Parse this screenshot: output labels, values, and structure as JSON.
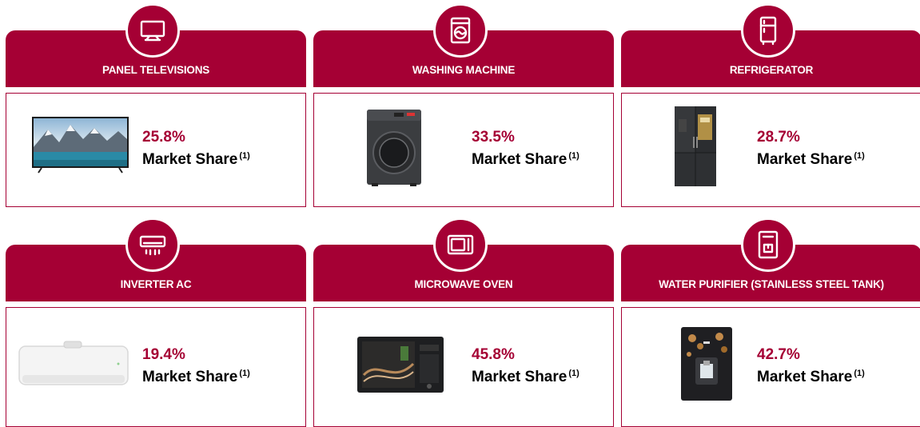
{
  "cards": [
    {
      "title": "PANEL TELEVISIONS",
      "percent": "25.8%",
      "label": "Market Share",
      "note": "(1)",
      "icon": "tv-icon",
      "image": "television"
    },
    {
      "title": "WASHING MACHINE",
      "percent": "33.5%",
      "label": "Market Share",
      "note": "(1)",
      "icon": "washing-machine-icon",
      "image": "washing-machine"
    },
    {
      "title": "REFRIGERATOR",
      "percent": "28.7%",
      "label": "Market Share",
      "note": "(1)",
      "icon": "refrigerator-icon",
      "image": "refrigerator"
    },
    {
      "title": "INVERTER AC",
      "percent": "19.4%",
      "label": "Market Share",
      "note": "(1)",
      "icon": "air-conditioner-icon",
      "image": "air-conditioner"
    },
    {
      "title": "MICROWAVE OVEN",
      "percent": "45.8%",
      "label": "Market Share",
      "note": "(1)",
      "icon": "microwave-icon",
      "image": "microwave-oven"
    },
    {
      "title": "WATER PURIFIER (STAINLESS STEEL TANK)",
      "percent": "42.7%",
      "label": "Market Share",
      "note": "(1)",
      "icon": "water-purifier-icon",
      "image": "water-purifier"
    }
  ],
  "colors": {
    "brand": "#a50034",
    "text": "#000000",
    "background": "#ffffff"
  }
}
